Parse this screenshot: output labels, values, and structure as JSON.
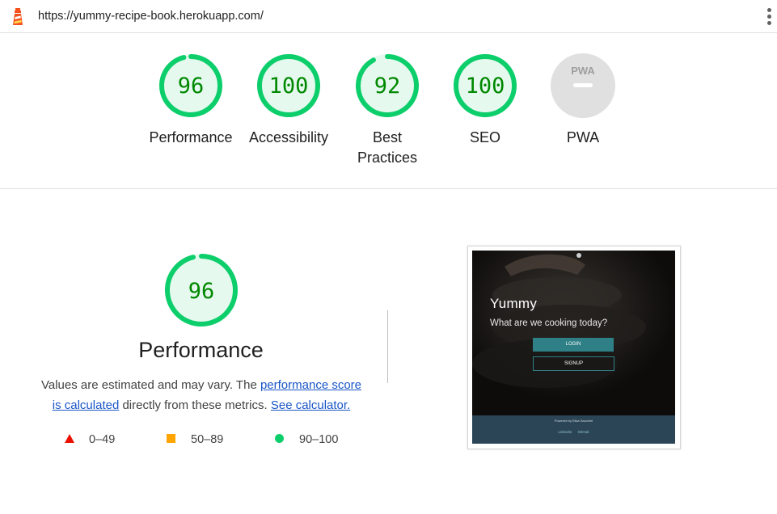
{
  "url_bar": {
    "url": "https://yummy-recipe-book.herokuapp.com/"
  },
  "gauges": [
    {
      "score": "96",
      "label": "Performance",
      "value": 0.96
    },
    {
      "score": "100",
      "label": "Accessibility",
      "value": 1.0
    },
    {
      "score": "92",
      "label": "Best Practices",
      "value": 0.92
    },
    {
      "score": "100",
      "label": "SEO",
      "value": 1.0
    },
    {
      "score": "",
      "label": "PWA",
      "badge": "PWA"
    }
  ],
  "performance": {
    "score": "96",
    "value": 0.96,
    "title": "Performance",
    "desc_1": "Values are estimated and may vary. The ",
    "link_score": "performance score is calculated",
    "desc_2": " directly from these metrics. ",
    "link_calc": "See calculator."
  },
  "legend": [
    {
      "range": "0–49",
      "color": "#eb0f00",
      "icon": "triangle-icon"
    },
    {
      "range": "50–89",
      "color": "#ffa400",
      "icon": "square-icon"
    },
    {
      "range": "90–100",
      "color": "#0cce6b",
      "icon": "circle-icon"
    }
  ],
  "thumbnail": {
    "brand": "Yummy",
    "tagline": "What are we cooking today?",
    "login": "LOGIN",
    "signup": "SIGNUP",
    "powered": "Powered by Elisa Saccheri",
    "link_linkedin": "LinkedIn",
    "link_github": "GitHub"
  },
  "colors": {
    "pass": "#0cce6b",
    "pass_text": "#008800",
    "pass_fill": "#e5f9ee",
    "link": "#1a56c8",
    "na": "#e0e0e0"
  }
}
